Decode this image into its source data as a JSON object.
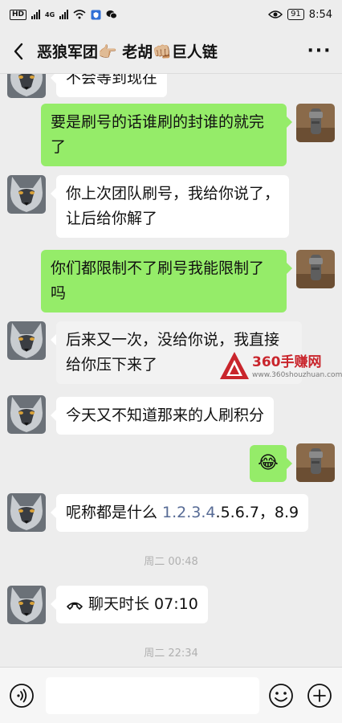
{
  "status_bar": {
    "left_chips": [
      "HD",
      "4G"
    ],
    "battery": "91",
    "time": "8:54"
  },
  "header": {
    "title": "恶狼军团👉🏼 老胡👊🏼巨人链",
    "back_icon": "chevron-left-icon",
    "more_label": "···"
  },
  "messages": {
    "m0_partial": "不会等到现在",
    "m1": "要是刷号的话谁刷的封谁的就完了",
    "m2": "你上次团队刷号，我给你说了，让后给你解了",
    "m3": "你们都限制不了刷号我能限制了吗",
    "m4": "后来又一次，没给你说，我直接给你压下来了",
    "m5": "今天又不知道那来的人刷积分",
    "m6_emoji": "😂",
    "m7_prefix": "呢称都是什么 ",
    "m7_link": "1.2.3.4",
    "m7_suffix": ".5.6.7，8.9",
    "ts1": "周二 00:48",
    "m8": "聊天时长 07:10",
    "ts2": "周二 22:34"
  },
  "watermark": {
    "brand": "360手赚网",
    "url": "www.360shouzhuan.com"
  },
  "input_bar": {
    "placeholder": ""
  },
  "colors": {
    "background": "#ededed",
    "outgoing_bubble": "#95ec69",
    "incoming_bubble": "#ffffff",
    "link": "#576b95",
    "watermark_red": "#c9252c"
  }
}
